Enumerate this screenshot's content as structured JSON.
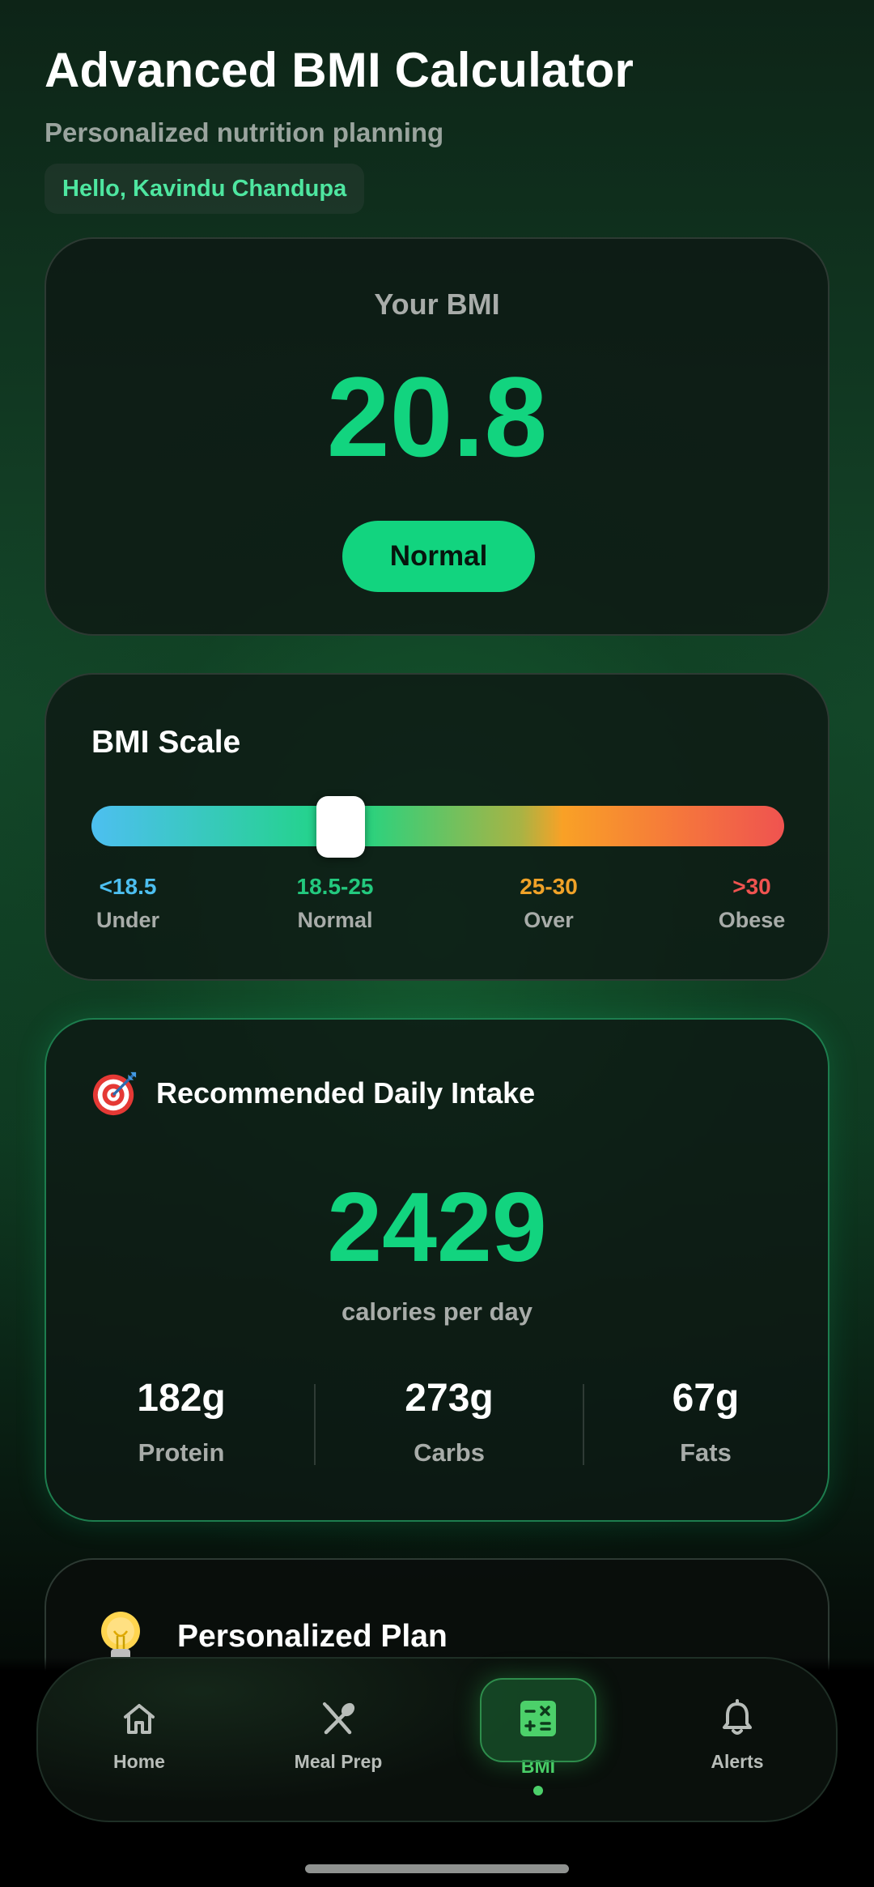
{
  "header": {
    "title": "Advanced BMI Calculator",
    "subtitle": "Personalized nutrition planning",
    "greeting": "Hello, Kavindu Chandupa"
  },
  "bmi": {
    "label": "Your BMI",
    "value": "20.8",
    "category": "Normal",
    "accent_color": "#12d47f"
  },
  "scale": {
    "title": "BMI Scale",
    "marker_position_fraction": 0.36,
    "ranges": [
      {
        "value": "<18.5",
        "name": "Under",
        "color": "#4dbff0"
      },
      {
        "value": "18.5-25",
        "name": "Normal",
        "color": "#23c97e"
      },
      {
        "value": "25-30",
        "name": "Over",
        "color": "#f0a228"
      },
      {
        "value": ">30",
        "name": "Obese",
        "color": "#ef5350"
      }
    ]
  },
  "intake": {
    "title": "Recommended Daily Intake",
    "icon": "target-icon",
    "calories": "2429",
    "calories_unit": "calories per day",
    "macros": [
      {
        "value": "182g",
        "name": "Protein"
      },
      {
        "value": "273g",
        "name": "Carbs"
      },
      {
        "value": "67g",
        "name": "Fats"
      }
    ]
  },
  "plan": {
    "title": "Personalized Plan",
    "icon": "lightbulb-icon"
  },
  "nav": {
    "active": "BMI",
    "items": [
      {
        "label": "Home",
        "icon": "home-icon"
      },
      {
        "label": "Meal Prep",
        "icon": "utensils-icon"
      },
      {
        "label": "BMI",
        "icon": "calculator-icon"
      },
      {
        "label": "Alerts",
        "icon": "bell-icon"
      }
    ],
    "active_color": "#4cd06a"
  }
}
